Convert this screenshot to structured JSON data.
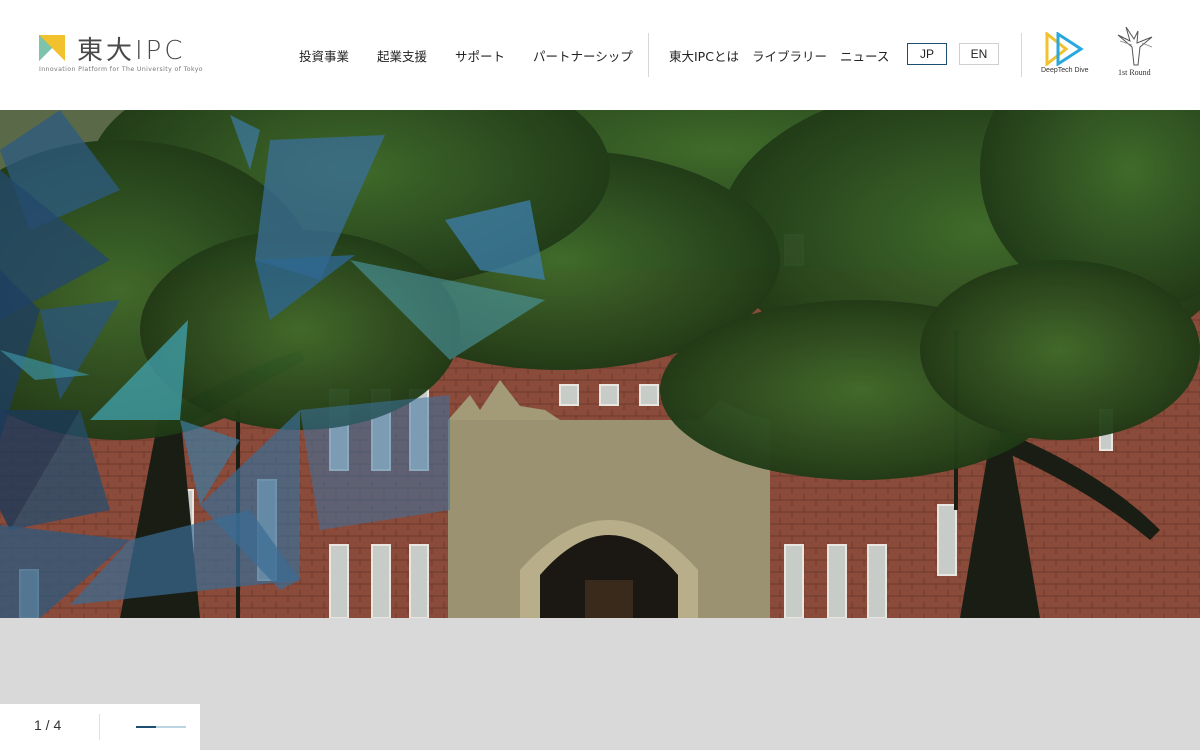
{
  "brand": {
    "name": "東大IPC",
    "tagline": "Innovation Platform for The University of Tokyo",
    "colors": {
      "yellow": "#f2c12e",
      "blue": "#29a8e0",
      "navy": "#1f4e73"
    }
  },
  "nav": {
    "items": [
      "投資事業",
      "起業支援",
      "サポート",
      "パートナーシップ"
    ],
    "secondary": [
      "東大IPCとは",
      "ライブラリー",
      "ニュース"
    ]
  },
  "language": {
    "options": [
      "JP",
      "EN"
    ],
    "selected": "JP"
  },
  "partners": [
    {
      "name": "DeepTech Dive",
      "icon": "play-triangle-icon"
    },
    {
      "name": "1st Round",
      "icon": "hummingbird-icon"
    }
  ],
  "hero": {
    "image": "campus-building-with-trees",
    "icon": "polygon-overlay-graphic"
  },
  "slider": {
    "current": 1,
    "total": 4,
    "label": "1 / 4",
    "progress": 0.4
  }
}
